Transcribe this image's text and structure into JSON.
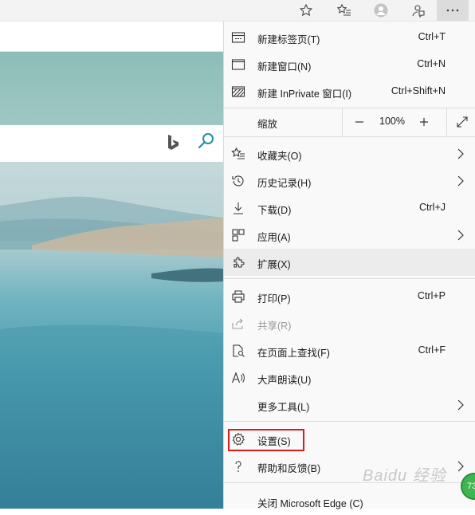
{
  "toolbar": {
    "buttons": [
      "favorites-star-icon",
      "favorites-list-icon",
      "profile-icon",
      "feedback-icon",
      "more-icon"
    ]
  },
  "menu": {
    "items": [
      {
        "label": "新建标签页(T)",
        "shortcut": "Ctrl+T",
        "icon": "new-tab-icon"
      },
      {
        "label": "新建窗口(N)",
        "shortcut": "Ctrl+N",
        "icon": "new-window-icon"
      },
      {
        "label": "新建 InPrivate 窗口(I)",
        "shortcut": "Ctrl+Shift+N",
        "icon": "inprivate-icon"
      }
    ],
    "zoom": {
      "label": "缩放",
      "value": "100%",
      "minus": "—",
      "plus": "+"
    },
    "items2": [
      {
        "label": "收藏夹(O)",
        "icon": "favorites-icon",
        "submenu": true
      },
      {
        "label": "历史记录(H)",
        "icon": "history-icon",
        "submenu": true
      },
      {
        "label": "下载(D)",
        "shortcut": "Ctrl+J",
        "icon": "download-icon"
      },
      {
        "label": "应用(A)",
        "icon": "apps-icon",
        "submenu": true
      },
      {
        "label": "扩展(X)",
        "icon": "extensions-icon"
      }
    ],
    "items3": [
      {
        "label": "打印(P)",
        "shortcut": "Ctrl+P",
        "icon": "print-icon"
      },
      {
        "label": "共享(R)",
        "icon": "share-icon",
        "disabled": true
      },
      {
        "label": "在页面上查找(F)",
        "shortcut": "Ctrl+F",
        "icon": "find-icon"
      },
      {
        "label": "大声朗读(U)",
        "icon": "read-aloud-icon"
      },
      {
        "label": "更多工具(L)",
        "icon": "more-tools-icon",
        "submenu": true
      }
    ],
    "items4": [
      {
        "label": "设置(S)",
        "icon": "settings-icon"
      },
      {
        "label": "帮助和反馈(B)",
        "icon": "help-icon",
        "submenu": true
      }
    ],
    "close": {
      "label": "关闭 Microsoft Edge (C)"
    }
  },
  "watermark": "Baidu 经验",
  "badge": "73",
  "colors": {
    "highlight_box": "#d91c1c",
    "menu_bg": "#f9f9f9",
    "hover_bg": "#ececec"
  }
}
